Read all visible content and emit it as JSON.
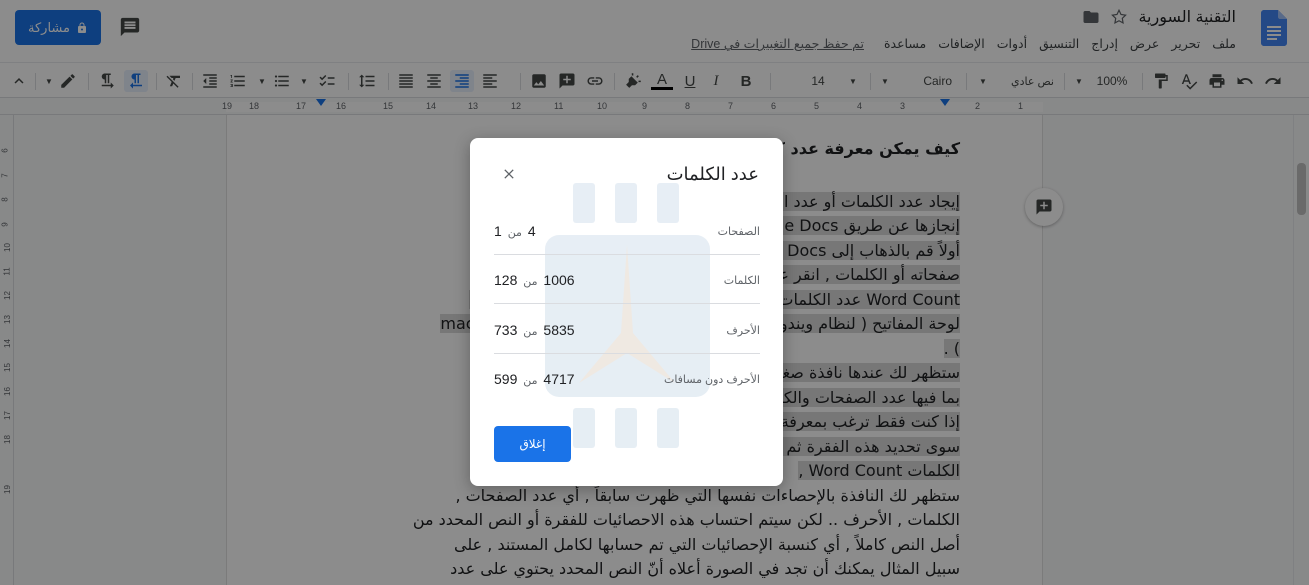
{
  "header": {
    "doc_title": "التقنية السورية",
    "share_label": "مشاركة",
    "save_status": "تم حفظ جميع التغييرات في Drive",
    "menu": [
      "ملف",
      "تحرير",
      "عرض",
      "إدراج",
      "التنسيق",
      "أدوات",
      "الإضافات",
      "مساعدة"
    ]
  },
  "toolbar": {
    "zoom": "100%",
    "style": "نص عادي",
    "font": "Cairo",
    "font_size": "14"
  },
  "ruler": {
    "numbers": [
      "19",
      "18",
      "17",
      "16",
      "15",
      "14",
      "13",
      "12",
      "11",
      "10",
      "9",
      "8",
      "7",
      "6",
      "5",
      "4",
      "3",
      "2",
      "1"
    ]
  },
  "vruler": {
    "numbers": [
      "6",
      "7",
      "8",
      "9",
      "10",
      "11",
      "12",
      "13",
      "14",
      "15",
      "16",
      "17",
      "18",
      "19"
    ]
  },
  "document": {
    "heading": "كيف يمكن معرفة عدد كلمات مستند في Google Docs",
    "para1": [
      "إيجاد عدد الكلمات أو عدد الصفحات في المستند عملية بسيطة جداً يمكن",
      "إنجازها عن طريق Google Docs بسهولة وبخطوات قليلة",
      "أولاً قم بالذهاب إلى Google Docs وافتح المستند الذي تريد معرفة عدد",
      "صفحاته أو الكلمات , انقر على قائمة أدوات في القائمة الرئيسية و اختر (",
      "Word Count عدد الكلمات ) أو اضغط على الاختصار Ctrl+Shift+C على",
      "لوحة المفاتيح ( لنظام ويندوز ) أو Command+Shift+C لنظام ماك mac OS",
      ") ."
    ],
    "para2": [
      "ستظهر لك عندها نافذة صغيرة تحتوي على إحصائيات تتعلق بمستندك",
      "بما فيها عدد الصفحات والكلمات والأحرف مع وبدون المسافات الفارغة ,",
      "إذا كنت فقط ترغب بمعرفة عدد كلمات فقرة معينة من المستند , ما عليك",
      "سوى تحديد هذه الفقرة ثم الذهاب إلى قائمة أدوات والنقر على خيار عدد",
      "الكلمات Word Count ,"
    ],
    "para3": [
      "ستظهر لك النافذة بالإحصاءات نفسها التي  ظهرت سابقاً , أي عدد الصفحات ,",
      "الكلمات , الأحرف .. لكن سيتم احتساب هذه الاحصائيات للفقرة أو النص المحدد من",
      "أصل النص كاملاً  , أي كنسبة الإحصائيات التي تم حسابها لكامل المستند , على",
      "سبيل المثال يمكنك أن تجد في الصورة أعلاه أنّ النص المحدد يحتوي على عدد"
    ]
  },
  "dialog": {
    "title": "عدد الكلمات",
    "close_label": "إغلاق",
    "of_word": "من",
    "stats": [
      {
        "label": "الصفحات",
        "value": "1",
        "total": "4"
      },
      {
        "label": "الكلمات",
        "value": "128",
        "total": "1006"
      },
      {
        "label": "الأحرف",
        "value": "733",
        "total": "5835"
      },
      {
        "label": "الأحرف دون مسافات",
        "value": "599",
        "total": "4717"
      }
    ]
  },
  "colors": {
    "accent": "#1a73e8",
    "selection": "#d9d9d9",
    "overlay": "rgba(0,0,0,0.45)"
  }
}
